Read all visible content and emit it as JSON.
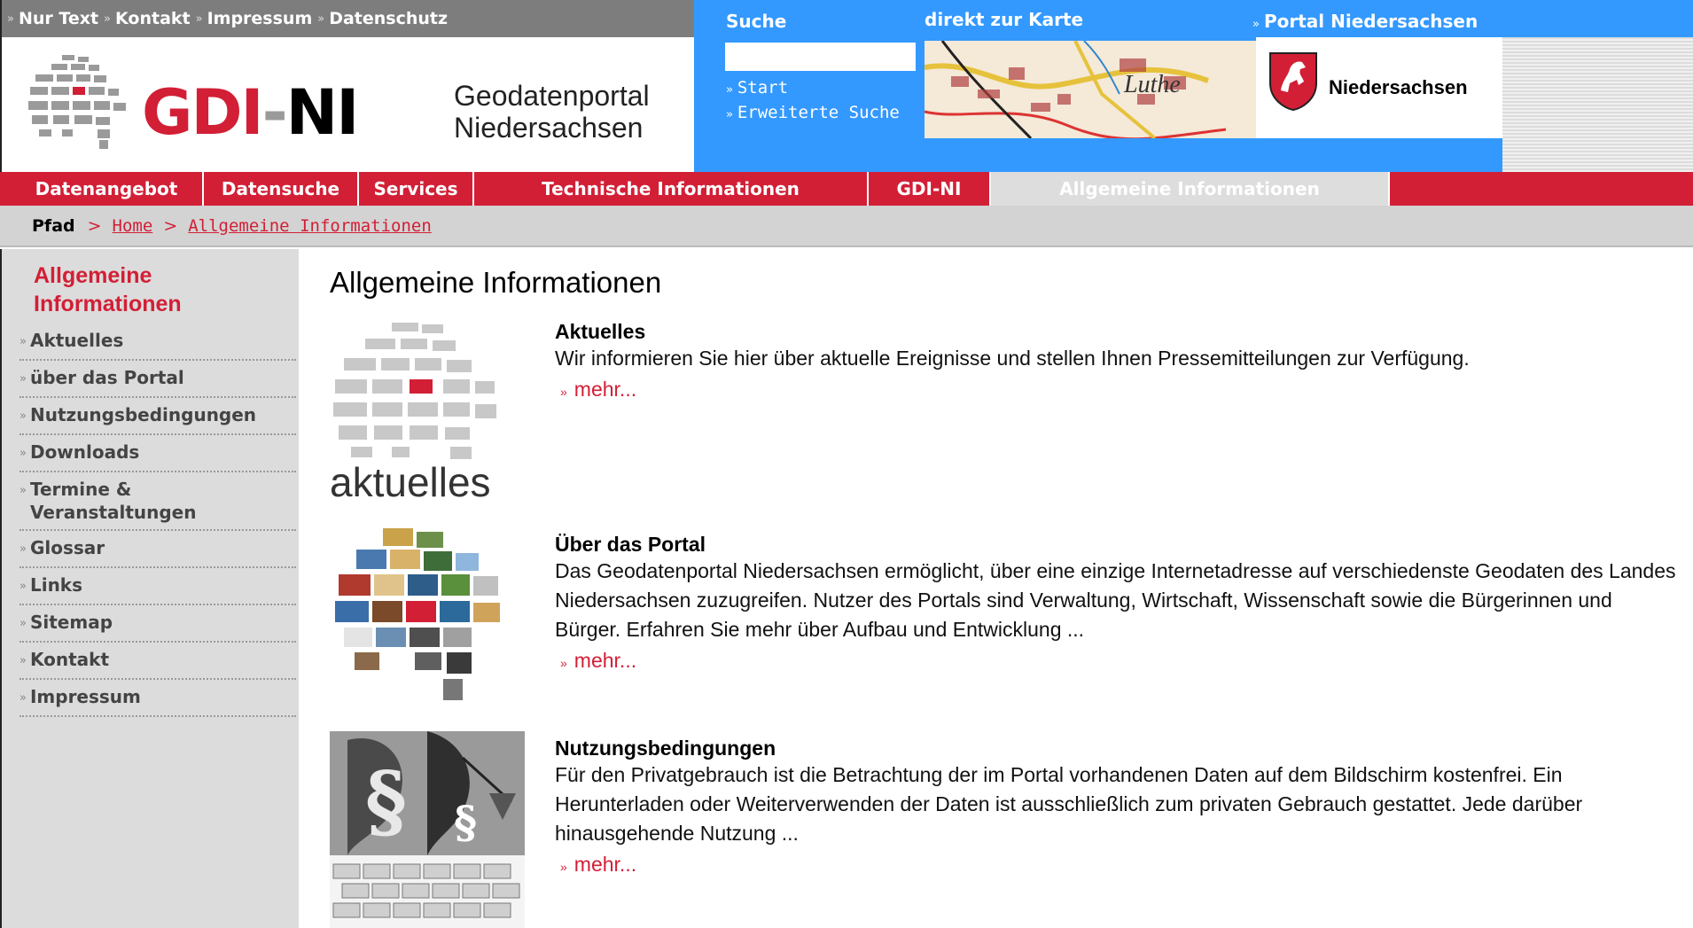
{
  "top_links": [
    "Nur Text",
    "Kontakt",
    "Impressum",
    "Datenschutz"
  ],
  "logo": {
    "gdi": "GDI",
    "dash": "-",
    "ni": "NI",
    "title_line1": "Geodatenportal",
    "title_line2": "Niedersachsen"
  },
  "search": {
    "label": "Suche",
    "placeholder": "",
    "links": [
      "Start",
      "Erweiterte Suche"
    ]
  },
  "map": {
    "label": "direkt zur Karte",
    "place": "Luthe"
  },
  "portal_ni": "Portal Niedersachsen",
  "state_name": "Niedersachsen",
  "nav": {
    "tabs": [
      {
        "label": "Datenangebot"
      },
      {
        "label": "Datensuche"
      },
      {
        "label": "Services"
      },
      {
        "label": "Technische Informationen"
      },
      {
        "label": "GDI-NI"
      },
      {
        "label": "Allgemeine Informationen",
        "active": true
      }
    ]
  },
  "path": {
    "label": "Pfad",
    "sep": ">",
    "crumbs": [
      "Home",
      "Allgemeine Informationen"
    ]
  },
  "sidebar": {
    "title_line1": "Allgemeine",
    "title_line2": "Informationen",
    "items": [
      {
        "label": "Aktuelles"
      },
      {
        "label": "über das Portal"
      },
      {
        "label": "Nutzungsbedingungen"
      },
      {
        "label": "Downloads"
      },
      {
        "label": "Termine & Veranstaltungen"
      },
      {
        "label": "Glossar"
      },
      {
        "label": "Links"
      },
      {
        "label": "Sitemap"
      },
      {
        "label": "Kontakt"
      },
      {
        "label": "Impressum"
      }
    ]
  },
  "main": {
    "heading": "Allgemeine Informationen",
    "entries": [
      {
        "title": "Aktuelles",
        "description": "Wir informieren Sie hier über aktuelle Ereignisse und stellen Ihnen Pressemitteilungen zur Verfügung.",
        "more": "mehr...",
        "thumb_caption": "aktuelles"
      },
      {
        "title": "Über das Portal",
        "description": "Das Geodatenportal Niedersachsen ermöglicht, über eine einzige Internetadresse auf verschiedenste Geodaten des Landes Niedersachsen zuzugreifen. Nutzer des Portals sind Verwaltung, Wirtschaft, Wissenschaft sowie die Bürgerinnen und Bürger. Erfahren Sie mehr über Aufbau und Entwicklung ...",
        "more": "mehr..."
      },
      {
        "title": "Nutzungsbedingungen",
        "description": "Für den Privatgebrauch ist die Betrachtung der im Portal vorhandenen Daten auf dem Bildschirm kostenfrei. Ein Herunterladen oder Weiterverwenden der Daten ist ausschließlich zum privaten Gebrauch gestattet. Jede darüber hinausgehende Nutzung ...",
        "more": "mehr..."
      }
    ]
  },
  "colors": {
    "brand_red": "#d21f36",
    "blue": "#3399ff",
    "grey_bar": "#7d7d7d",
    "sidebar_bg": "#dcdcdc"
  }
}
